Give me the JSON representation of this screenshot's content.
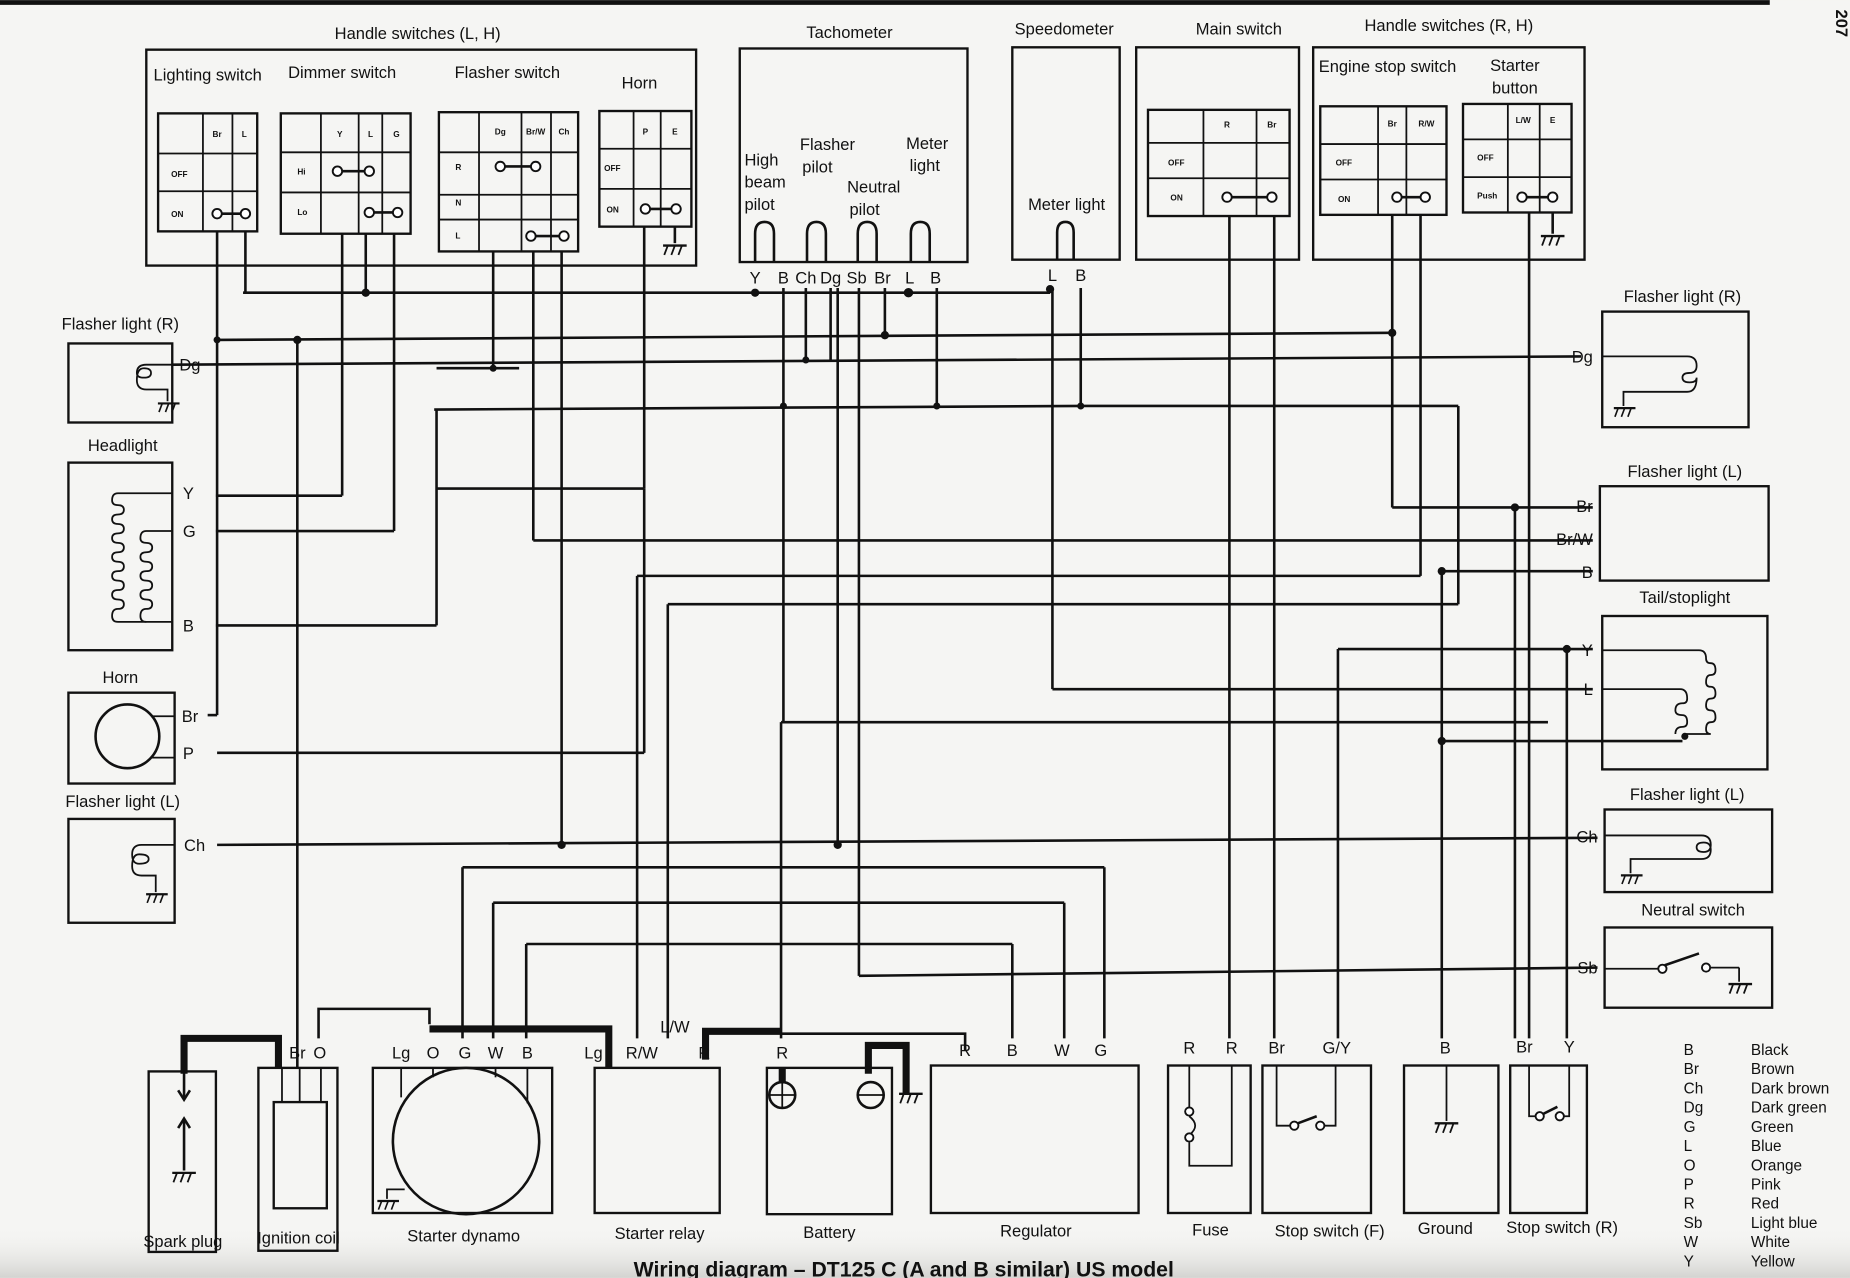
{
  "title": "Wiring diagram – DT125 C (A and B similar) US model",
  "page_number": "207",
  "components": {
    "handle_switches_lh": {
      "title": "Handle switches (L, H)",
      "lighting_switch": {
        "title": "Lighting switch",
        "cols": [
          "Br",
          "L"
        ],
        "rows": [
          "OFF",
          "ON"
        ]
      },
      "dimmer_switch": {
        "title": "Dimmer switch",
        "cols": [
          "Y",
          "L",
          "G"
        ],
        "rows": [
          "Hi",
          "Lo"
        ]
      },
      "flasher_switch": {
        "title": "Flasher switch",
        "cols": [
          "Dg",
          "Br/W",
          "Ch"
        ],
        "rows": [
          "R",
          "N",
          "L"
        ]
      },
      "horn": {
        "title": "Horn",
        "cols": [
          "P",
          "E"
        ],
        "rows": [
          "OFF",
          "ON"
        ]
      }
    },
    "tachometer": {
      "title": "Tachometer",
      "high_beam_pilot": "High beam pilot",
      "flasher_pilot": "Flasher pilot",
      "neutral_pilot": "Neutral pilot",
      "meter_light": "Meter light",
      "terminals": [
        "Y",
        "B",
        "Ch",
        "Dg",
        "Sb",
        "Br",
        "L",
        "B"
      ]
    },
    "speedometer": {
      "title": "Speedometer",
      "meter_light": "Meter light",
      "terminals": [
        "L",
        "B"
      ]
    },
    "main_switch": {
      "title": "Main switch",
      "cols": [
        "R",
        "Br"
      ],
      "rows": [
        "OFF",
        "ON"
      ]
    },
    "handle_switches_rh": {
      "title": "Handle switches (R, H)",
      "engine_stop_switch": {
        "title": "Engine stop switch",
        "cols": [
          "Br",
          "R/W"
        ],
        "rows": [
          "OFF",
          "ON"
        ]
      },
      "starter_button": {
        "title": "Starter button",
        "cols": [
          "L/W",
          "E"
        ],
        "rows": [
          "OFF",
          "Push"
        ]
      }
    },
    "left_side": {
      "flasher_light_r": {
        "title": "Flasher light (R)",
        "terminals": [
          "Dg"
        ]
      },
      "headlight": {
        "title": "Headlight",
        "terminals": [
          "Y",
          "G",
          "B"
        ]
      },
      "horn": {
        "title": "Horn",
        "terminals": [
          "Br",
          "P"
        ]
      },
      "flasher_light_l": {
        "title": "Flasher light (L)",
        "terminals": [
          "Ch"
        ]
      }
    },
    "right_side": {
      "flasher_light_r": {
        "title": "Flasher light (R)",
        "terminals": [
          "Dg"
        ]
      },
      "flasher_light_l_top": {
        "title": "Flasher light (L)",
        "terminals": [
          "Br",
          "Br/W",
          "B"
        ]
      },
      "tail_stoplight": {
        "title": "Tail/stoplight",
        "terminals": [
          "Y",
          "L"
        ]
      },
      "flasher_light_l": {
        "title": "Flasher light (L)",
        "terminals": [
          "Ch"
        ]
      },
      "neutral_switch": {
        "title": "Neutral switch",
        "terminals": [
          "Sb"
        ]
      }
    },
    "bottom": {
      "spark_plug": {
        "title": "Spark plug"
      },
      "ignition_coil": {
        "title": "Ignition coil",
        "terminals": [
          "Br",
          "O"
        ]
      },
      "starter_dynamo": {
        "title": "Starter dynamo",
        "terminals": [
          "Lg",
          "O",
          "G",
          "W",
          "B"
        ]
      },
      "starter_relay": {
        "title": "Starter relay",
        "terminals": [
          "Lg",
          "R/W",
          "L/W",
          "R"
        ]
      },
      "battery": {
        "title": "Battery",
        "terminals": [
          "R"
        ]
      },
      "regulator": {
        "title": "Regulator",
        "terminals": [
          "R",
          "B",
          "W",
          "G"
        ]
      },
      "fuse": {
        "title": "Fuse",
        "terminals": [
          "R",
          "R"
        ]
      },
      "stop_switch_f": {
        "title": "Stop switch (F)",
        "terminals": [
          "Br",
          "G/Y"
        ]
      },
      "ground": {
        "title": "Ground",
        "terminals": [
          "B"
        ]
      },
      "stop_switch_r": {
        "title": "Stop switch (R)",
        "terminals": [
          "Br",
          "Y"
        ]
      }
    }
  },
  "legend": [
    {
      "code": "B",
      "color": "Black"
    },
    {
      "code": "Br",
      "color": "Brown"
    },
    {
      "code": "Ch",
      "color": "Dark brown"
    },
    {
      "code": "Dg",
      "color": "Dark green"
    },
    {
      "code": "G",
      "color": "Green"
    },
    {
      "code": "L",
      "color": "Blue"
    },
    {
      "code": "O",
      "color": "Orange"
    },
    {
      "code": "P",
      "color": "Pink"
    },
    {
      "code": "R",
      "color": "Red"
    },
    {
      "code": "Sb",
      "color": "Light blue"
    },
    {
      "code": "W",
      "color": "White"
    },
    {
      "code": "Y",
      "color": "Yellow"
    }
  ]
}
